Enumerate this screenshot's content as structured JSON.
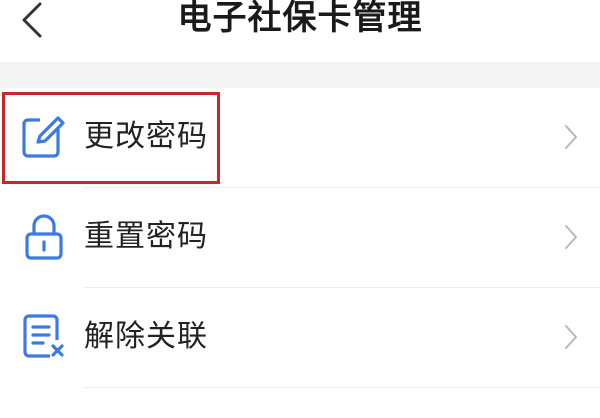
{
  "header": {
    "title": "电子社保卡管理",
    "back_icon": "chevron-left-icon"
  },
  "menu": {
    "items": [
      {
        "label": "更改密码",
        "icon": "edit-icon"
      },
      {
        "label": "重置密码",
        "icon": "lock-icon"
      },
      {
        "label": "解除关联",
        "icon": "unlink-document-icon"
      }
    ]
  },
  "colors": {
    "accent": "#3b7ae0",
    "highlight_border": "#c8282d",
    "section_gap": "#f3f3f3"
  }
}
